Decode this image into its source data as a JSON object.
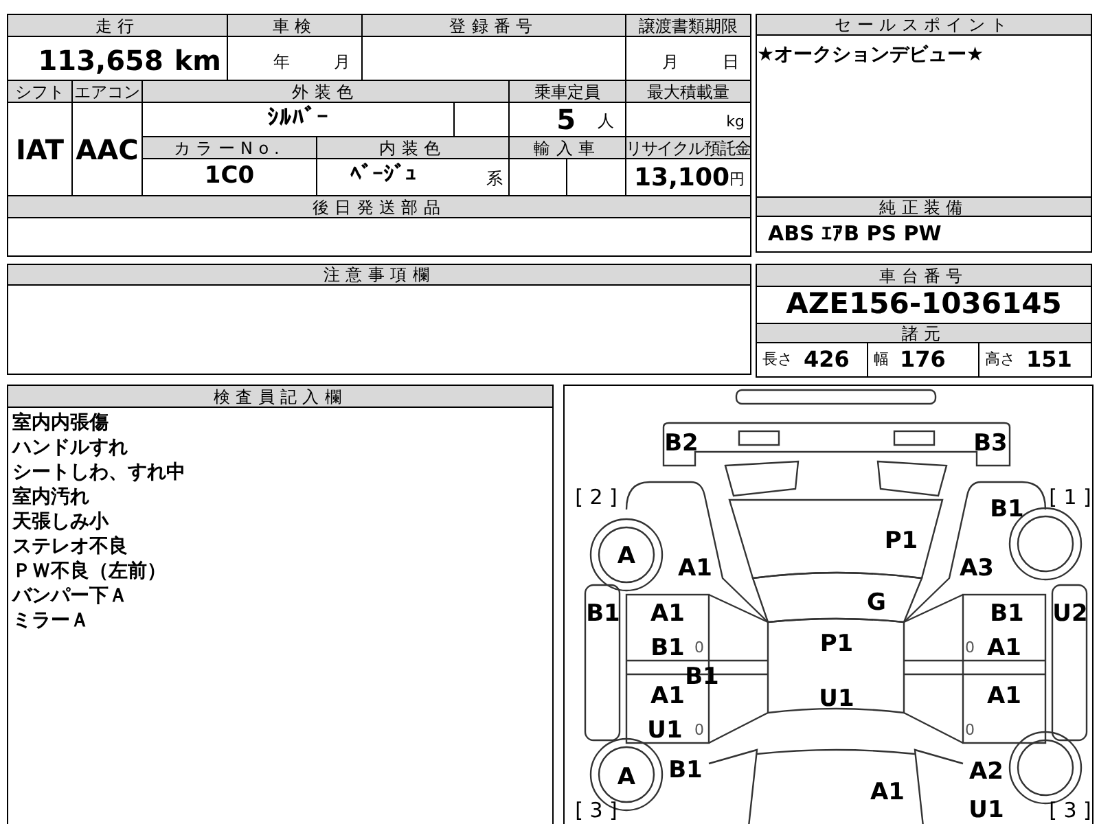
{
  "vehicle_table": {
    "mileage": {
      "label": "走行",
      "value": "113,658",
      "unit": "km"
    },
    "inspection": {
      "label": "車検",
      "year_unit": "年",
      "month_unit": "月"
    },
    "registration_number": {
      "label": "登録番号"
    },
    "transfer_deadline": {
      "label": "譲渡書類期限",
      "month_unit": "月",
      "day_unit": "日"
    },
    "shift": {
      "label": "シフト",
      "value": "IAT"
    },
    "air_conditioner": {
      "label": "エアコン",
      "value": "AAC"
    },
    "exterior_color": {
      "label": "外装色",
      "value": "ｼﾙﾊﾞｰ"
    },
    "capacity": {
      "label": "乗車定員",
      "value": "5",
      "unit": "人"
    },
    "max_load": {
      "label": "最大積載量",
      "unit": "kg"
    },
    "color_no": {
      "label": "カラーNo.",
      "value": "1C0"
    },
    "interior_color": {
      "label": "内装色",
      "value": "ﾍﾞｰｼﾞｭ",
      "suffix": "系"
    },
    "imported": {
      "label": "輸入車"
    },
    "recycle_fee": {
      "label": "リサイクル預託金",
      "value": "13,100",
      "unit": "円"
    },
    "parts_to_ship": {
      "label": "後日発送部品"
    }
  },
  "sales_point": {
    "label": "セールスポイント",
    "text": "★オークションデビュー★"
  },
  "standard_equipment": {
    "label": "純正装備",
    "text": "ABS ｴｱB PS PW"
  },
  "notes": {
    "label": "注意事項欄"
  },
  "chassis": {
    "label": "車台番号",
    "value": "AZE156-1036145"
  },
  "specs": {
    "label": "諸元",
    "items": [
      {
        "label": "長さ",
        "value": "426"
      },
      {
        "label": "幅",
        "value": "176"
      },
      {
        "label": "高さ",
        "value": "151"
      }
    ]
  },
  "inspector_notes": {
    "label": "検査員記入欄",
    "lines": [
      "室内内張傷",
      "ハンドルすれ",
      "シートしわ、すれ中",
      "室内汚れ",
      "天張しみ小",
      "ステレオ不良",
      "ＰＷ不良（左前）",
      "バンパー下Ａ",
      "ミラーＡ"
    ]
  },
  "diagram": {
    "corner_labels": [
      "[ 2 ]",
      "[ 1 ]",
      "[ 3 ]",
      "[ 3 ]"
    ],
    "marks": [
      {
        "kind": "code",
        "text": "B2"
      },
      {
        "kind": "code",
        "text": "B3"
      },
      {
        "kind": "code",
        "text": "B1"
      },
      {
        "kind": "code",
        "text": "P1"
      },
      {
        "kind": "code",
        "text": "A"
      },
      {
        "kind": "code",
        "text": "A1"
      },
      {
        "kind": "code",
        "text": "A3"
      },
      {
        "kind": "code",
        "text": "G"
      },
      {
        "kind": "code",
        "text": "B1"
      },
      {
        "kind": "code",
        "text": "A1"
      },
      {
        "kind": "code",
        "text": "B1"
      },
      {
        "kind": "code",
        "text": "U2"
      },
      {
        "kind": "code",
        "text": "B1"
      },
      {
        "kind": "faint",
        "text": "0"
      },
      {
        "kind": "code",
        "text": "P1"
      },
      {
        "kind": "faint",
        "text": "0"
      },
      {
        "kind": "code",
        "text": "A1"
      },
      {
        "kind": "code",
        "text": "B1"
      },
      {
        "kind": "code",
        "text": "A1"
      },
      {
        "kind": "code",
        "text": "U1"
      },
      {
        "kind": "code",
        "text": "A1"
      },
      {
        "kind": "code",
        "text": "U1"
      },
      {
        "kind": "faint",
        "text": "0"
      },
      {
        "kind": "faint",
        "text": "0"
      },
      {
        "kind": "code",
        "text": "A"
      },
      {
        "kind": "code",
        "text": "B1"
      },
      {
        "kind": "code",
        "text": "A2"
      },
      {
        "kind": "code",
        "text": "A1"
      },
      {
        "kind": "code",
        "text": "U1"
      }
    ]
  }
}
